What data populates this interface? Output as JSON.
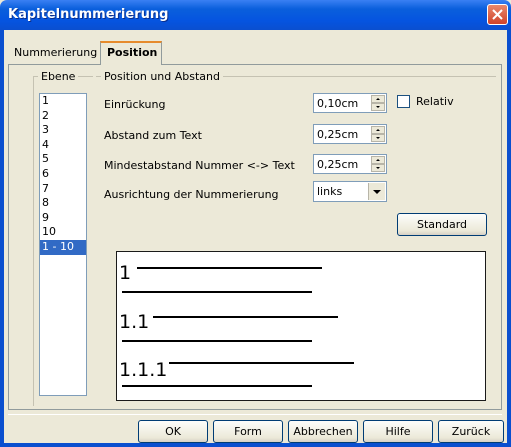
{
  "window": {
    "title": "Kapitelnummerierung"
  },
  "tabs": [
    {
      "label": "Nummerierung"
    },
    {
      "label": "Position"
    }
  ],
  "levels": {
    "label": "Ebene",
    "items": [
      "1",
      "2",
      "3",
      "4",
      "5",
      "6",
      "7",
      "8",
      "9",
      "10",
      "1 - 10"
    ],
    "selected": "1 - 10"
  },
  "position": {
    "group_label": "Position und Abstand",
    "indent": {
      "label": "Einrückung",
      "value": "0,10cm"
    },
    "relative": {
      "label": "Relativ",
      "checked": false
    },
    "text_distance": {
      "label": "Abstand zum Text",
      "value": "0,25cm"
    },
    "min_distance": {
      "label": "Mindestabstand Nummer <-> Text",
      "value": "0,25cm"
    },
    "alignment": {
      "label": "Ausrichtung der Nummerierung",
      "value": "links"
    },
    "default_button": "Standard"
  },
  "preview": {
    "lines": [
      "1",
      "1.1",
      "1.1.1"
    ]
  },
  "footer": {
    "ok": "OK",
    "form": "Form",
    "cancel": "Abbrechen",
    "help": "Hilfe",
    "reset": "Zurück"
  },
  "colors": {
    "title_bar": "#0554e0",
    "selection": "#316ac5",
    "active_tab_accent": "#e68b2c"
  }
}
